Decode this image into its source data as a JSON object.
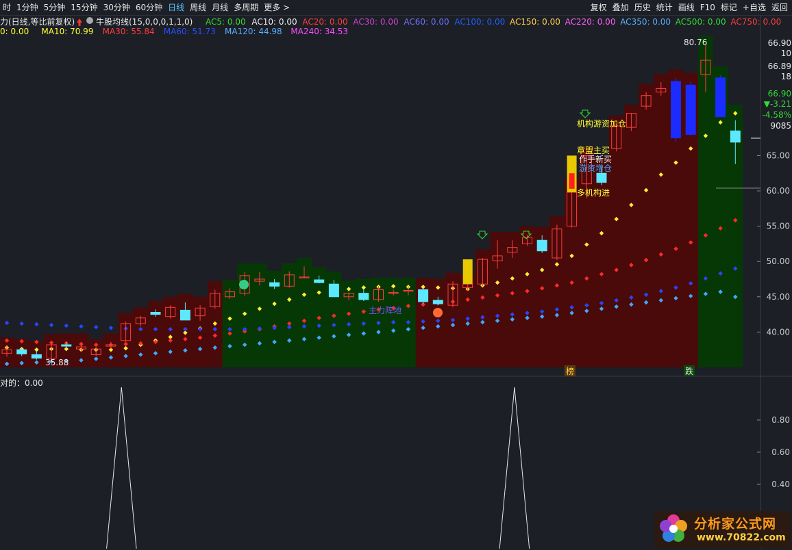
{
  "toolbar": {
    "periods": [
      {
        "label": "时",
        "active": false
      },
      {
        "label": "1分钟",
        "active": false
      },
      {
        "label": "5分钟",
        "active": false
      },
      {
        "label": "15分钟",
        "active": false
      },
      {
        "label": "30分钟",
        "active": false
      },
      {
        "label": "60分钟",
        "active": false
      },
      {
        "label": "日线",
        "active": true
      },
      {
        "label": "周线",
        "active": false
      },
      {
        "label": "月线",
        "active": false
      },
      {
        "label": "多周期",
        "active": false
      },
      {
        "label": "更多 >",
        "active": false
      }
    ],
    "actions": [
      "复权",
      "叠加",
      "历史",
      "统计",
      "画线",
      "F10",
      "标记",
      "+自选",
      "返回"
    ]
  },
  "indicator_header": {
    "title": "力(日线,等比前复权)",
    "formula": "牛股均线(15,0,0,0,1,1,0)",
    "ac_items": [
      {
        "label": "AC5: 0.00",
        "color": "#33dd33"
      },
      {
        "label": "AC10: 0.00",
        "color": "#f0f0f0"
      },
      {
        "label": "AC20: 0.00",
        "color": "#ff3c3c"
      },
      {
        "label": "AC30: 0.00",
        "color": "#d040d0"
      },
      {
        "label": "AC60: 0.00",
        "color": "#7070ff"
      },
      {
        "label": "AC100: 0.00",
        "color": "#2060ff"
      },
      {
        "label": "AC150: 0.00",
        "color": "#ffd04a"
      },
      {
        "label": "AC220: 0.00",
        "color": "#ff60ff"
      },
      {
        "label": "AC350: 0.00",
        "color": "#5ab0ff"
      },
      {
        "label": "AC500: 0.00",
        "color": "#33dd33"
      },
      {
        "label": "AC750: 0.00",
        "color": "#ff3c3c"
      }
    ],
    "ma_items": [
      {
        "label": "0: 0.00",
        "color": "#ffff33"
      },
      {
        "label": "MA10: 70.99",
        "color": "#ffff33"
      },
      {
        "label": "MA30: 55.84",
        "color": "#ff3c3c"
      },
      {
        "label": "MA60: 51.73",
        "color": "#2a4cff"
      },
      {
        "label": "MA120: 44.98",
        "color": "#5ab0ff"
      },
      {
        "label": "MA240: 34.53",
        "color": "#ff4cff"
      }
    ]
  },
  "price_axis": {
    "labels": [
      "65.00",
      "60.00",
      "55.00",
      "50.00",
      "45.00",
      "40.00"
    ],
    "info": [
      "66.90",
      "10",
      "66.89",
      "18",
      "66.90",
      "▼-3.21",
      "-4.58%",
      "9085"
    ]
  },
  "annotations": {
    "high": "80.76",
    "low": "35.88",
    "zhuli": "主力阵地",
    "jigou_jiacang": "机构游资加仓",
    "zhangmeng": "章盟主买",
    "zuoshou": "作手新买",
    "youzi": "游资增仓",
    "duojigou": "多机构进",
    "tag_bang": "榜",
    "tag_die": "跌"
  },
  "sub_panel": {
    "title": "对的：0.00",
    "labels": [
      "0.80",
      "0.60",
      "0.40"
    ]
  },
  "watermark": {
    "title": "分析家公式网",
    "url": "www.70822.com"
  },
  "chart_data": {
    "type": "candlestick",
    "candles": [
      [
        37,
        38,
        36.5,
        37.5
      ],
      [
        37.5,
        37.8,
        36.6,
        36.9
      ],
      [
        36.8,
        37.3,
        36.1,
        36.3
      ],
      [
        36.3,
        38.5,
        36,
        38.2
      ],
      [
        38.2,
        38.6,
        37.6,
        38.0
      ],
      [
        37.6,
        38.6,
        37.2,
        37.9
      ],
      [
        36.8,
        37.8,
        36.6,
        37.6
      ],
      [
        38.0,
        38.6,
        37.6,
        38.2
      ],
      [
        38.8,
        41.5,
        38.5,
        41.2
      ],
      [
        41.2,
        42.3,
        40.8,
        42.0
      ],
      [
        42.8,
        43.2,
        42.2,
        42.5
      ],
      [
        42.2,
        43.8,
        41.9,
        43.5
      ],
      [
        43.1,
        44.2,
        41.8,
        41.7
      ],
      [
        42.3,
        43.8,
        41.6,
        43.4
      ],
      [
        43.6,
        46.0,
        43.3,
        45.5
      ],
      [
        45.0,
        46.2,
        44.7,
        45.7
      ],
      [
        45.5,
        48.5,
        45.1,
        48.0
      ],
      [
        47.2,
        48.5,
        46.6,
        47.5
      ],
      [
        47.0,
        47.5,
        46.1,
        46.5
      ],
      [
        46.5,
        48.6,
        46.3,
        48.1
      ],
      [
        47.8,
        49.3,
        47.6,
        47.8
      ],
      [
        47.4,
        48.0,
        46.9,
        47.0
      ],
      [
        46.8,
        47.4,
        45.0,
        45.0
      ],
      [
        45.0,
        45.6,
        44.5,
        45.5
      ],
      [
        45.5,
        46.0,
        44.4,
        44.6
      ],
      [
        44.6,
        46.5,
        44.3,
        46.0
      ],
      [
        45.5,
        46.0,
        45.2,
        45.6
      ],
      [
        45.8,
        46.5,
        45.2,
        45.9
      ],
      [
        46.0,
        46.2,
        44.0,
        44.3
      ],
      [
        44.5,
        45.0,
        43.8,
        44.0
      ],
      [
        43.8,
        47.2,
        43.5,
        46.8
      ],
      [
        46.3,
        47.0,
        45.8,
        46.8
      ],
      [
        46.8,
        50.5,
        46.5,
        50.3
      ],
      [
        50.1,
        53.0,
        49.0,
        50.8
      ],
      [
        51.3,
        53.0,
        50.5,
        52.0
      ],
      [
        52.5,
        53.8,
        52.2,
        53.4
      ],
      [
        53.0,
        53.7,
        51.2,
        51.5
      ],
      [
        50.5,
        55.2,
        50.2,
        54.6
      ],
      [
        55.0,
        60.5,
        54.8,
        59.8
      ],
      [
        61.0,
        65.0,
        59.0,
        65.0
      ],
      [
        62.5,
        63.5,
        60.8,
        61.2
      ],
      [
        66.0,
        69.5,
        65.6,
        69.2
      ],
      [
        69.0,
        71.0,
        68.5,
        71.0
      ],
      [
        72.0,
        74.0,
        71.5,
        73.5
      ],
      [
        74.0,
        75.4,
        73.5,
        74.5
      ],
      [
        75.5,
        76.0,
        67.0,
        67.5
      ],
      [
        68.0,
        75.5,
        67.8,
        75.0
      ],
      [
        76.5,
        80.76,
        74.0,
        78.5
      ],
      [
        76.0,
        76.4,
        70.5,
        70.5
      ],
      [
        68.5,
        70.0,
        63.8,
        66.9
      ]
    ],
    "series": [
      {
        "name": "MA10",
        "values": [
          37.8,
          37.6,
          37.5,
          37.6,
          37.6,
          37.5,
          37.5,
          37.5,
          37.7,
          38.2,
          38.8,
          39.3,
          39.9,
          40.5,
          41.2,
          41.9,
          42.6,
          43.3,
          44.0,
          44.6,
          45.3,
          45.6,
          45.9,
          46.1,
          46.3,
          46.4,
          46.5,
          46.4,
          46.4,
          46.3,
          46.2,
          46.1,
          46.6,
          47.0,
          47.6,
          48.2,
          48.8,
          49.6,
          50.8,
          52.4,
          54.0,
          56.0,
          58.0,
          60.1,
          62.3,
          64.0,
          66.0,
          67.8,
          69.7,
          70.99
        ]
      },
      {
        "name": "MA30",
        "values": [
          38.8,
          38.7,
          38.6,
          38.5,
          38.4,
          38.3,
          38.2,
          38.2,
          38.3,
          38.4,
          38.6,
          38.8,
          39.0,
          39.2,
          39.5,
          39.8,
          40.1,
          40.4,
          40.8,
          41.2,
          41.6,
          42.0,
          42.3,
          42.6,
          42.9,
          43.2,
          43.4,
          43.7,
          43.9,
          44.1,
          44.3,
          44.6,
          44.9,
          45.2,
          45.5,
          45.8,
          46.2,
          46.6,
          47.0,
          47.6,
          48.2,
          48.8,
          49.5,
          50.2,
          51.0,
          51.8,
          52.7,
          53.7,
          54.7,
          55.84
        ]
      },
      {
        "name": "MA60",
        "values": [
          41.3,
          41.2,
          41.1,
          41.0,
          40.9,
          40.8,
          40.7,
          40.6,
          40.5,
          40.4,
          40.4,
          40.4,
          40.4,
          40.4,
          40.4,
          40.4,
          40.4,
          40.5,
          40.6,
          40.7,
          40.8,
          40.9,
          41.0,
          41.1,
          41.2,
          41.3,
          41.4,
          41.4,
          41.5,
          41.6,
          41.7,
          41.9,
          42.1,
          42.3,
          42.5,
          42.7,
          42.9,
          43.2,
          43.5,
          43.8,
          44.1,
          44.5,
          44.9,
          45.3,
          45.8,
          46.3,
          46.9,
          47.6,
          48.3,
          49.0
        ]
      },
      {
        "name": "MA120",
        "values": [
          35.5,
          35.6,
          35.7,
          35.8,
          35.9,
          36.0,
          36.2,
          36.4,
          36.6,
          36.8,
          37.0,
          37.2,
          37.4,
          37.6,
          37.8,
          38.0,
          38.2,
          38.4,
          38.6,
          38.8,
          39.0,
          39.2,
          39.4,
          39.6,
          39.8,
          40.0,
          40.2,
          40.4,
          40.6,
          40.8,
          41.0,
          41.2,
          41.4,
          41.6,
          41.8,
          42.0,
          42.2,
          42.4,
          42.7,
          43.0,
          43.3,
          43.6,
          43.9,
          44.2,
          44.5,
          44.8,
          45.1,
          45.4,
          45.7,
          44.98
        ]
      }
    ],
    "backgrounds": [
      {
        "from": 0,
        "to": 14,
        "color": "#4a0a0a"
      },
      {
        "from": 15,
        "to": 27,
        "color": "#063806"
      },
      {
        "from": 28,
        "to": 46,
        "color": "#4a0a0a"
      },
      {
        "from": 47,
        "to": 49,
        "color": "#063806"
      }
    ],
    "ylim": [
      35,
      82
    ],
    "sub_series": [
      0,
      0,
      0,
      0,
      0,
      0,
      0,
      1,
      0,
      0,
      0,
      0,
      0,
      0,
      0,
      0,
      0,
      0,
      0,
      0,
      0,
      0,
      0,
      0,
      0,
      0,
      0,
      0,
      0,
      0,
      0,
      1,
      0,
      0,
      0,
      0,
      0,
      0,
      0,
      0,
      0,
      0,
      0,
      0,
      0,
      0,
      0,
      0,
      0,
      0
    ],
    "sub_ylim": [
      0,
      1
    ]
  }
}
